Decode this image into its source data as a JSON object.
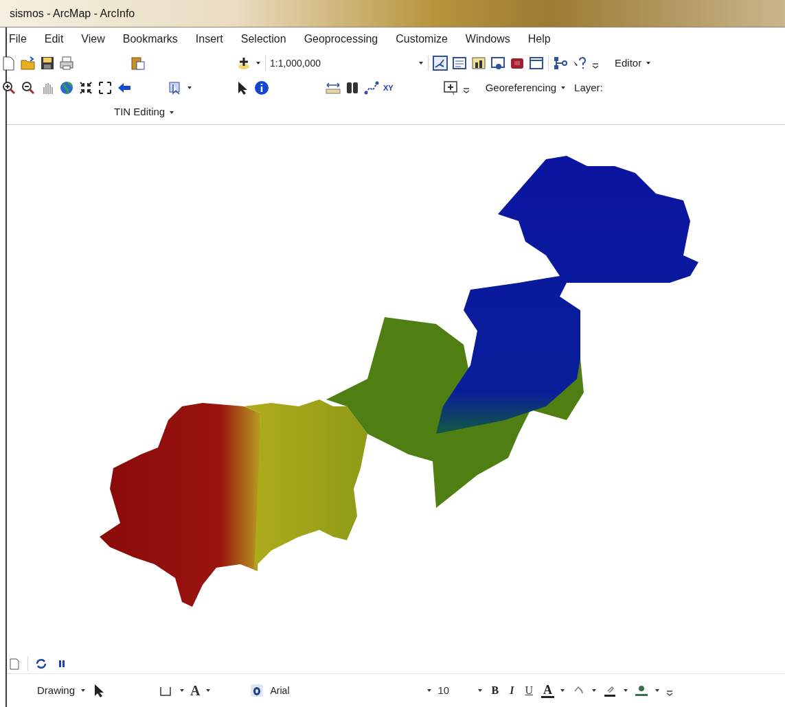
{
  "window": {
    "title": "sismos - ArcMap - ArcInfo"
  },
  "menu": [
    "File",
    "Edit",
    "View",
    "Bookmarks",
    "Insert",
    "Selection",
    "Geoprocessing",
    "Customize",
    "Windows",
    "Help"
  ],
  "standard_toolbar": {
    "scale": "1:1,000,000",
    "editor": "Editor"
  },
  "tools_toolbar": {
    "xy_label": "XY",
    "georeferencing": "Georeferencing",
    "layer_label": "Layer:"
  },
  "tin_toolbar": {
    "label": "TIN Editing"
  },
  "drawing_toolbar": {
    "label": "Drawing",
    "text_tool": "A",
    "font": "Arial",
    "font_size": "10",
    "bold": "B",
    "italic": "I",
    "underline": "U",
    "font_color": "A"
  }
}
